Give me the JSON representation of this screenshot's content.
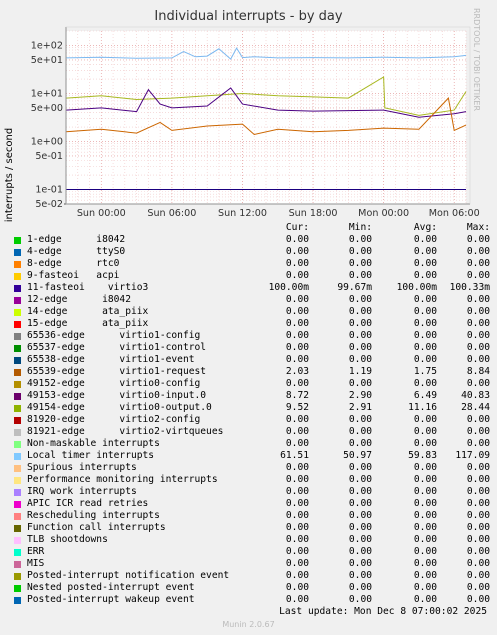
{
  "chart_data": {
    "type": "line",
    "title": "Individual interrupts - by day",
    "ylabel": "interrupts / second",
    "yscale": "log",
    "ylim": [
      0.05,
      200
    ],
    "y_ticks": [
      "5e-02",
      "1e-01",
      "5e-01",
      "1e+00",
      "5e+00",
      "1e+01",
      "5e+01",
      "1e+02"
    ],
    "x_ticks": [
      "Sun 00:00",
      "Sun 06:00",
      "Sun 12:00",
      "Sun 18:00",
      "Mon 00:00",
      "Mon 06:00"
    ],
    "x_range_hours": [
      -3,
      31
    ],
    "series": [
      {
        "name": "Local timer interrupts",
        "color": "#7cb8f0",
        "x": [
          -3,
          0,
          3,
          6,
          7,
          8,
          9,
          10,
          11,
          11.5,
          12,
          13,
          15,
          18,
          21,
          24,
          27,
          30,
          31
        ],
        "y": [
          55,
          57,
          54,
          55,
          75,
          58,
          60,
          85,
          52,
          88,
          56,
          58,
          55,
          56,
          55,
          57,
          55,
          58,
          62
        ]
      },
      {
        "name": "virtio0-output.0",
        "color": "#a8b820",
        "x": [
          -3,
          0,
          3,
          6,
          9,
          12,
          15,
          18,
          21,
          24,
          24.1,
          27,
          30,
          31
        ],
        "y": [
          8,
          9,
          7.5,
          8,
          9,
          10,
          9,
          8.5,
          8,
          22,
          5,
          3.5,
          4.5,
          11
        ]
      },
      {
        "name": "virtio0-input.0",
        "color": "#4b0082",
        "x": [
          -3,
          0,
          3,
          4,
          5,
          6,
          9,
          11,
          12,
          15,
          18,
          21,
          24,
          27,
          30,
          31
        ],
        "y": [
          4.5,
          5,
          4.2,
          12,
          6,
          5,
          5.5,
          13,
          6,
          4.5,
          4.3,
          4.4,
          4.5,
          3.2,
          3.8,
          4.2
        ]
      },
      {
        "name": "virtio1-request",
        "color": "#cc6600",
        "x": [
          -3,
          0,
          3,
          5,
          6,
          9,
          12,
          13,
          15,
          18,
          21,
          24,
          27,
          29.5,
          30,
          31
        ],
        "y": [
          1.6,
          1.8,
          1.5,
          2.5,
          1.7,
          2.1,
          2.3,
          1.4,
          1.8,
          1.6,
          1.7,
          1.9,
          1.8,
          8,
          1.7,
          2.2
        ]
      },
      {
        "name": "virtio3",
        "color": "#1a0080",
        "x": [
          -3,
          31
        ],
        "y": [
          0.1,
          0.1
        ]
      }
    ]
  },
  "legend": {
    "header": {
      "cur": "Cur:",
      "min": "Min:",
      "avg": "Avg:",
      "max": "Max:"
    },
    "rows": [
      {
        "color": "#00cc00",
        "label": "1-edge      i8042",
        "cur": "0.00",
        "min": "0.00",
        "avg": "0.00",
        "max": "0.00"
      },
      {
        "color": "#0066b3",
        "label": "4-edge      ttyS0",
        "cur": "0.00",
        "min": "0.00",
        "avg": "0.00",
        "max": "0.00"
      },
      {
        "color": "#ff8000",
        "label": "8-edge      rtc0",
        "cur": "0.00",
        "min": "0.00",
        "avg": "0.00",
        "max": "0.00"
      },
      {
        "color": "#ffcc00",
        "label": "9-fasteoi   acpi",
        "cur": "0.00",
        "min": "0.00",
        "avg": "0.00",
        "max": "0.00"
      },
      {
        "color": "#330099",
        "label": "11-fasteoi    virtio3",
        "cur": "100.00m",
        "min": "99.67m",
        "avg": "100.00m",
        "max": "100.33m"
      },
      {
        "color": "#990099",
        "label": "12-edge      i8042",
        "cur": "0.00",
        "min": "0.00",
        "avg": "0.00",
        "max": "0.00"
      },
      {
        "color": "#ccff00",
        "label": "14-edge      ata_piix",
        "cur": "0.00",
        "min": "0.00",
        "avg": "0.00",
        "max": "0.00"
      },
      {
        "color": "#ff0000",
        "label": "15-edge      ata_piix",
        "cur": "0.00",
        "min": "0.00",
        "avg": "0.00",
        "max": "0.00"
      },
      {
        "color": "#808080",
        "label": "65536-edge      virtio1-config",
        "cur": "0.00",
        "min": "0.00",
        "avg": "0.00",
        "max": "0.00"
      },
      {
        "color": "#008f00",
        "label": "65537-edge      virtio1-control",
        "cur": "0.00",
        "min": "0.00",
        "avg": "0.00",
        "max": "0.00"
      },
      {
        "color": "#00487d",
        "label": "65538-edge      virtio1-event",
        "cur": "0.00",
        "min": "0.00",
        "avg": "0.00",
        "max": "0.00"
      },
      {
        "color": "#b35a00",
        "label": "65539-edge      virtio1-request",
        "cur": "2.03",
        "min": "1.19",
        "avg": "1.75",
        "max": "8.84"
      },
      {
        "color": "#b38f00",
        "label": "49152-edge      virtio0-config",
        "cur": "0.00",
        "min": "0.00",
        "avg": "0.00",
        "max": "0.00"
      },
      {
        "color": "#6b006b",
        "label": "49153-edge      virtio0-input.0",
        "cur": "8.72",
        "min": "2.90",
        "avg": "6.49",
        "max": "40.83"
      },
      {
        "color": "#8fb300",
        "label": "49154-edge      virtio0-output.0",
        "cur": "9.52",
        "min": "2.91",
        "avg": "11.16",
        "max": "28.44"
      },
      {
        "color": "#b30000",
        "label": "81920-edge      virtio2-config",
        "cur": "0.00",
        "min": "0.00",
        "avg": "0.00",
        "max": "0.00"
      },
      {
        "color": "#bebebe",
        "label": "81921-edge      virtio2-virtqueues",
        "cur": "0.00",
        "min": "0.00",
        "avg": "0.00",
        "max": "0.00"
      },
      {
        "color": "#80ff80",
        "label": "Non-maskable interrupts",
        "cur": "0.00",
        "min": "0.00",
        "avg": "0.00",
        "max": "0.00"
      },
      {
        "color": "#80c9ff",
        "label": "Local timer interrupts",
        "cur": "61.51",
        "min": "50.97",
        "avg": "59.83",
        "max": "117.09"
      },
      {
        "color": "#ffc080",
        "label": "Spurious interrupts",
        "cur": "0.00",
        "min": "0.00",
        "avg": "0.00",
        "max": "0.00"
      },
      {
        "color": "#ffe680",
        "label": "Performance monitoring interrupts",
        "cur": "0.00",
        "min": "0.00",
        "avg": "0.00",
        "max": "0.00"
      },
      {
        "color": "#aa80ff",
        "label": "IRQ work interrupts",
        "cur": "0.00",
        "min": "0.00",
        "avg": "0.00",
        "max": "0.00"
      },
      {
        "color": "#ee00cc",
        "label": "APIC ICR read retries",
        "cur": "0.00",
        "min": "0.00",
        "avg": "0.00",
        "max": "0.00"
      },
      {
        "color": "#ff8080",
        "label": "Rescheduling interrupts",
        "cur": "0.00",
        "min": "0.00",
        "avg": "0.00",
        "max": "0.00"
      },
      {
        "color": "#666600",
        "label": "Function call interrupts",
        "cur": "0.00",
        "min": "0.00",
        "avg": "0.00",
        "max": "0.00"
      },
      {
        "color": "#ffbfff",
        "label": "TLB shootdowns",
        "cur": "0.00",
        "min": "0.00",
        "avg": "0.00",
        "max": "0.00"
      },
      {
        "color": "#00ffcc",
        "label": "ERR",
        "cur": "0.00",
        "min": "0.00",
        "avg": "0.00",
        "max": "0.00"
      },
      {
        "color": "#cc6699",
        "label": "MIS",
        "cur": "0.00",
        "min": "0.00",
        "avg": "0.00",
        "max": "0.00"
      },
      {
        "color": "#999900",
        "label": "Posted-interrupt notification event",
        "cur": "0.00",
        "min": "0.00",
        "avg": "0.00",
        "max": "0.00"
      },
      {
        "color": "#00cc00",
        "label": "Nested posted-interrupt event",
        "cur": "0.00",
        "min": "0.00",
        "avg": "0.00",
        "max": "0.00"
      },
      {
        "color": "#0066b3",
        "label": "Posted-interrupt wakeup event",
        "cur": "0.00",
        "min": "0.00",
        "avg": "0.00",
        "max": "0.00"
      }
    ]
  },
  "footer": {
    "last_update": "Last update: Mon Dec  8 07:00:02 2025",
    "munin": "Munin 2.0.67"
  },
  "side_label": "RRDTOOL / TOBI OETIKER"
}
